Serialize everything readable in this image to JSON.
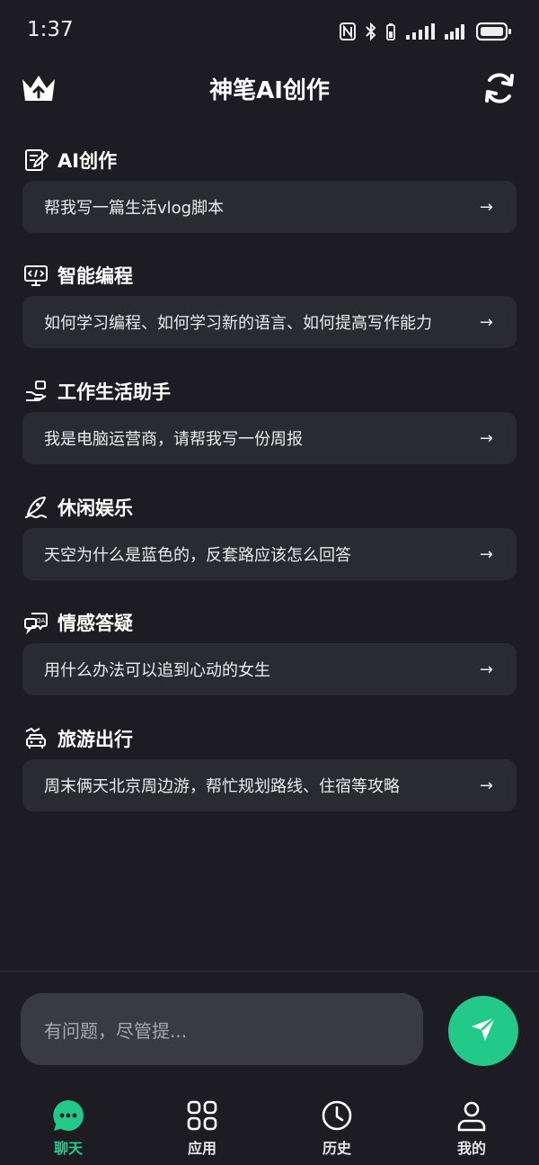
{
  "status_bar": {
    "time": "1:37"
  },
  "header": {
    "title": "神笔AI创作",
    "left_icon": "crown-upload-icon",
    "right_icon": "refresh-icon"
  },
  "sections": [
    {
      "icon": "edit-note-icon",
      "title": "AI创作",
      "prompt": "帮我写一篇生活vlog脚本",
      "arrow": "→"
    },
    {
      "icon": "code-monitor-icon",
      "title": "智能编程",
      "prompt": "如何学习编程、如何学习新的语言、如何提高写作能力",
      "arrow": "→"
    },
    {
      "icon": "hand-helper-icon",
      "title": "工作生活助手",
      "prompt": "我是电脑运营商，请帮我写一份周报",
      "arrow": "→"
    },
    {
      "icon": "surfing-icon",
      "title": "休闲娱乐",
      "prompt": "天空为什么是蓝色的，反套路应该怎么回答",
      "arrow": "→"
    },
    {
      "icon": "qa-chat-icon",
      "title": "情感答疑",
      "prompt": "用什么办法可以追到心动的女生",
      "arrow": "→"
    },
    {
      "icon": "travel-car-icon",
      "title": "旅游出行",
      "prompt": "周末俩天北京周边游，帮忙规划路线、住宿等攻略",
      "arrow": "→"
    }
  ],
  "input": {
    "placeholder": "有问题，尽管提..."
  },
  "nav": [
    {
      "label": "聊天",
      "icon": "chat-bubble-icon",
      "active": true
    },
    {
      "label": "应用",
      "icon": "apps-grid-icon",
      "active": false
    },
    {
      "label": "历史",
      "icon": "clock-icon",
      "active": false
    },
    {
      "label": "我的",
      "icon": "user-icon",
      "active": false
    }
  ],
  "colors": {
    "background": "#1c1c22",
    "card": "#2a2b31",
    "accent": "#22c989",
    "input": "#3a3b42"
  }
}
